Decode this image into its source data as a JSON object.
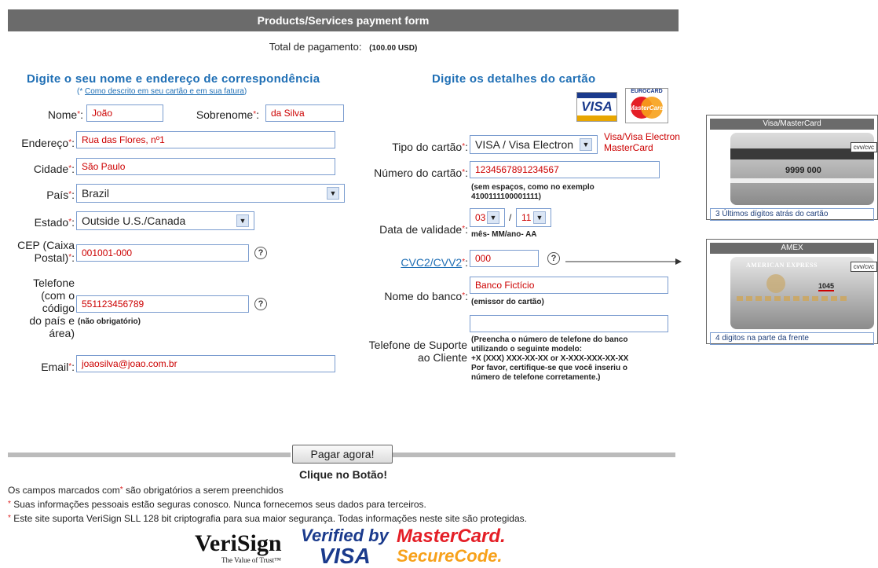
{
  "header": {
    "title": "Products/Services payment form"
  },
  "total": {
    "label": "Total de pagamento:",
    "value": "(100.00 USD)"
  },
  "left": {
    "title": "Digite o seu nome e endereço de correspondência",
    "subtitle_prefix": "(* ",
    "subtitle_link": "Como descrito em seu cartão e em sua fatura",
    "subtitle_suffix": ")",
    "nome_label": "Nome",
    "nome_value": "João",
    "sobrenome_label": "Sobrenome",
    "sobrenome_value": "da Silva",
    "endereco_label": "Endereço",
    "endereco_value": "Rua das Flores, nº1",
    "cidade_label": "Cidade",
    "cidade_value": "São Paulo",
    "pais_label": "País",
    "pais_value": "Brazil",
    "estado_label": "Estado",
    "estado_value": "Outside U.S./Canada",
    "cep_label_1": "CEP (Caixa",
    "cep_label_2": "Postal)",
    "cep_value": "001001-000",
    "telefone_label_1": "Telefone",
    "telefone_label_2": "(com o",
    "telefone_label_3": "código",
    "telefone_label_4": "do país e",
    "telefone_label_5": "área)",
    "telefone_value": "551123456789",
    "telefone_note": "(não obrigatório)",
    "email_label": "Email",
    "email_value": "joaosilva@joao.com.br"
  },
  "right": {
    "title": "Digite os detalhes do cartão",
    "tipo_label": "Tipo do cartão",
    "tipo_value": "VISA / Visa Electron",
    "tipo_note_1": "Visa/Visa Electron",
    "tipo_note_2": "MasterCard",
    "numero_label": "Número do cartão",
    "numero_value": "1234567891234567",
    "numero_note_1": "(sem espaços, como no exemplo",
    "numero_note_2": "4100111100001111)",
    "validade_label": "Data de validade",
    "mes_value": "03",
    "sep": "/",
    "ano_value": "11",
    "validade_note": "mês- MM/ano- AA",
    "cvc_label": "CVC2/CVV2",
    "cvc_value": "000",
    "banco_label": "Nome do banco",
    "banco_value": "Banco Fictício",
    "banco_note": "(emissor do cartão)",
    "suporte_label_1": "Telefone de Suporte",
    "suporte_label_2": "ao Cliente",
    "suporte_value": "",
    "suporte_note": [
      "(Preencha o número de telefone do banco",
      "utilizando o seguinte modelo:",
      "+X (XXX) XXX-XX-XX or X-XXX-XXX-XX-XX",
      "Por favor, certifique-se que você inseriu o",
      "número de telefone corretamente.)"
    ]
  },
  "cards": {
    "visa_logo": "VISA",
    "mc_top": "EUROCARD",
    "mc_text": "MasterCard",
    "vm_title": "Visa/MasterCard",
    "vm_digits": "9999 000",
    "vm_sig": "cvv/cvc",
    "vm_foot": "3 Últimos dígitos atrás do cartão",
    "amex_title": "AMEX",
    "amex_brand": "AMERICAN EXPRESS",
    "amex_code": "1045",
    "amex_sig": "cvv/cvc",
    "amex_foot": "4 digitos na parte da frente"
  },
  "submit": {
    "button": "Pagar agora!",
    "hint": "Clique no Botão!"
  },
  "footer": {
    "line1_a": "Os campos marcados com",
    "line1_b": "são obrigatórios a serem preenchidos",
    "line2": "Suas informações pessoais estão seguras conosco. Nunca fornecemos seus dados para terceiros.",
    "line3": "Este site suporta VeriSign SLL 128 bit criptografia para sua maior segurança. Todas informações neste site são protegidas.",
    "star": "*"
  },
  "logos": {
    "verisign": "VeriSign",
    "verisign_tag": "The Value of Trust™",
    "vbv_1": "Verified by",
    "vbv_2": "VISA",
    "mc_1": "MasterCard.",
    "mc_2": "SecureCode."
  },
  "colors": {
    "accent": "#1f6fb5",
    "required": "#d22",
    "header": "#6b6b6b"
  }
}
